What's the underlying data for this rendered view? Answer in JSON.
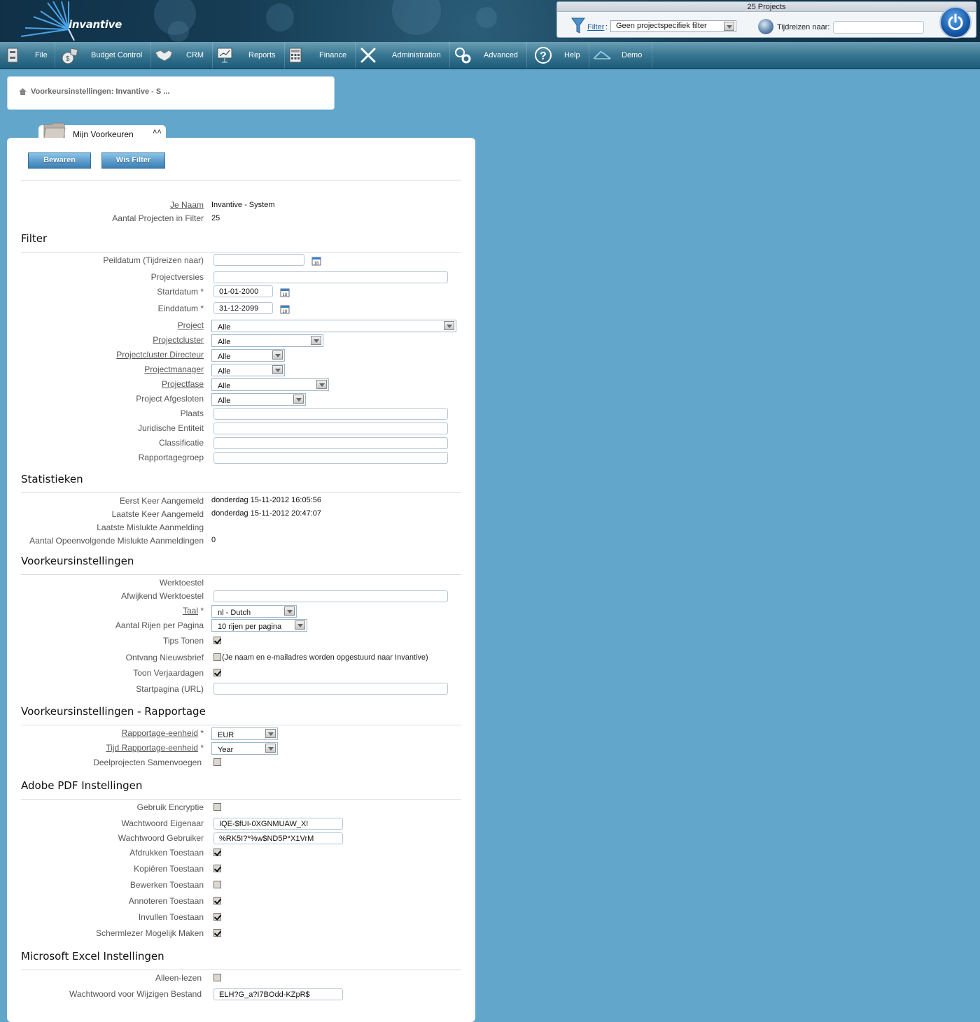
{
  "app": {
    "logo_text": "invantive"
  },
  "topbar": {
    "project_count": "25 Projects",
    "filter_link": "Filter",
    "filter_colon": ":",
    "filter_value": "Geen projectspecifiek filter",
    "travel_label": "Tijdreizen naar:",
    "travel_value": ""
  },
  "nav": [
    {
      "label": "File",
      "icon": "file-cabinet-icon"
    },
    {
      "label": "Budget Control",
      "icon": "money-bag-icon"
    },
    {
      "label": "CRM",
      "icon": "handshake-icon"
    },
    {
      "label": "Reports",
      "icon": "presentation-chart-icon"
    },
    {
      "label": "Finance",
      "icon": "calculator-icon"
    },
    {
      "label": "Administration",
      "icon": "tools-icon"
    },
    {
      "label": "Advanced",
      "icon": "gears-icon"
    },
    {
      "label": "Help",
      "icon": "help-icon"
    },
    {
      "label": "Demo",
      "icon": "demo-logo-icon"
    }
  ],
  "breadcrumb": {
    "text": "Voorkeursinstellingen: Invantive - S ..."
  },
  "tab": {
    "label": "Mijn Voorkeuren",
    "collapse_glyph": "⌃"
  },
  "buttons": {
    "save": "Bewaren",
    "clear_filter": "Wis Filter"
  },
  "general": {
    "name_label": "Je Naam",
    "name_value": "Invantive - System",
    "count_label": "Aantal Projecten in Filter",
    "count_value": "25"
  },
  "sections": {
    "filter": "Filter",
    "stats": "Statistieken",
    "prefs": "Voorkeursinstellingen",
    "reporting": "Voorkeursinstellingen - Rapportage",
    "pdf": "Adobe PDF Instellingen",
    "excel": "Microsoft Excel Instellingen"
  },
  "filter": {
    "peildatum": {
      "label": "Peildatum (Tijdreizen naar)",
      "value": ""
    },
    "projectversies": {
      "label": "Projectversies",
      "value": ""
    },
    "startdatum": {
      "label": "Startdatum *",
      "value": "01-01-2000"
    },
    "einddatum": {
      "label": "Einddatum *",
      "value": "31-12-2099"
    },
    "project": {
      "label": "Project",
      "value": "Alle"
    },
    "projectcluster": {
      "label": "Projectcluster",
      "value": "Alle"
    },
    "cluster_directeur": {
      "label": "Projectcluster Directeur",
      "value": "Alle"
    },
    "projectmanager": {
      "label": "Projectmanager",
      "value": "Alle"
    },
    "projectfase": {
      "label": "Projectfase",
      "value": "Alle"
    },
    "afgesloten": {
      "label": "Project Afgesloten",
      "value": "Alle"
    },
    "plaats": {
      "label": "Plaats",
      "value": ""
    },
    "juridische_entiteit": {
      "label": "Juridische Entiteit",
      "value": ""
    },
    "classificatie": {
      "label": "Classificatie",
      "value": ""
    },
    "rapportagegroep": {
      "label": "Rapportagegroep",
      "value": ""
    }
  },
  "stats": {
    "first_login": {
      "label": "Eerst Keer Aangemeld",
      "value": "donderdag 15-11-2012 16:05:56"
    },
    "last_login": {
      "label": "Laatste Keer Aangemeld",
      "value": "donderdag 15-11-2012 20:47:07"
    },
    "last_failed": {
      "label": "Laatste Mislukte Aanmelding",
      "value": ""
    },
    "failed_count": {
      "label": "Aantal Opeenvolgende Mislukte Aanmeldingen",
      "value": "0"
    }
  },
  "prefs": {
    "werktoestel": {
      "label": "Werktoestel",
      "value": ""
    },
    "afwijkend": {
      "label": "Afwijkend Werktoestel",
      "value": ""
    },
    "taal": {
      "label": "Taal",
      "required": " *",
      "value": "nl - Dutch"
    },
    "rows": {
      "label": "Aantal Rijen per Pagina",
      "value": "10 rijen per pagina"
    },
    "tips": {
      "label": "Tips Tonen",
      "checked": true
    },
    "newsletter": {
      "label": "Ontvang Nieuwsbrief",
      "checked": false,
      "hint": "(Je naam en e-mailadres worden opgestuurd naar Invantive)"
    },
    "birthdays": {
      "label": "Toon Verjaardagen",
      "checked": true
    },
    "startpage": {
      "label": "Startpagina (URL)",
      "value": ""
    }
  },
  "reporting": {
    "unit": {
      "label": "Rapportage-eenheid",
      "required": " *",
      "value": "EUR"
    },
    "time_unit": {
      "label": "Tijd Rapportage-eenheid",
      "required": " *",
      "value": "Year"
    },
    "merge": {
      "label": "Deelprojecten Samenvoegen",
      "checked": false
    }
  },
  "pdf": {
    "encryption": {
      "label": "Gebruik Encryptie",
      "checked": false
    },
    "owner_pw": {
      "label": "Wachtwoord Eigenaar",
      "value": "IQE-$fUI-0XGNMUAW_X!"
    },
    "user_pw": {
      "label": "Wachtwoord Gebruiker",
      "value": "%RK5I?*%w$ND5P*X1VrM"
    },
    "print": {
      "label": "Afdrukken Toestaan",
      "checked": true
    },
    "copy": {
      "label": "Kopiëren Toestaan",
      "checked": true
    },
    "edit": {
      "label": "Bewerken Toestaan",
      "checked": false
    },
    "annotate": {
      "label": "Annoteren Toestaan",
      "checked": true
    },
    "fill": {
      "label": "Invullen Toestaan",
      "checked": true
    },
    "screenreader": {
      "label": "Schermlezer Mogelijk Maken",
      "checked": true
    }
  },
  "excel": {
    "readonly": {
      "label": "Alleen-lezen",
      "checked": false
    },
    "modify_pw": {
      "label": "Wachtwoord voor Wijzigen Bestand",
      "value": "ELH?G_a?I7BOdd-KZpR$"
    }
  }
}
